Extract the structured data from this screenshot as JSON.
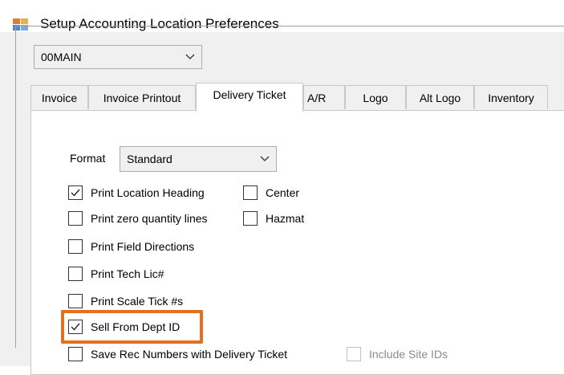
{
  "window": {
    "title": "Setup Accounting Location Preferences",
    "icon": "app-window-icon"
  },
  "location_select": {
    "value": "00MAIN",
    "icon": "chevron-down-icon"
  },
  "tabs": [
    {
      "label": "Invoice",
      "active": false
    },
    {
      "label": "Invoice Printout",
      "active": false
    },
    {
      "label": "Delivery Ticket",
      "active": true
    },
    {
      "label": "A/R",
      "active": false
    },
    {
      "label": "Logo",
      "active": false
    },
    {
      "label": "Alt Logo",
      "active": false
    },
    {
      "label": "Inventory",
      "active": false
    }
  ],
  "delivery_ticket": {
    "format_label": "Format",
    "format_value": "Standard",
    "options": {
      "print_location_heading": {
        "label": "Print Location Heading",
        "checked": true
      },
      "center": {
        "label": "Center",
        "checked": false
      },
      "print_zero_quantity_lines": {
        "label": "Print zero quantity lines",
        "checked": false
      },
      "hazmat": {
        "label": "Hazmat",
        "checked": false
      },
      "print_field_directions": {
        "label": "Print Field Directions",
        "checked": false
      },
      "print_tech_lic": {
        "label": "Print Tech Lic#",
        "checked": false
      },
      "print_scale_tick": {
        "label": "Print Scale Tick #s",
        "checked": false
      },
      "sell_from_dept_id": {
        "label": "Sell From Dept ID",
        "checked": true
      },
      "save_rec_numbers": {
        "label": "Save Rec Numbers with Delivery Ticket",
        "checked": false
      },
      "include_site_ids": {
        "label": "Include Site IDs",
        "checked": false,
        "disabled": true
      }
    }
  },
  "colors": {
    "highlight": "#e2701e",
    "window_bg": "#f0f0f0",
    "panel_bg": "#ffffff"
  }
}
